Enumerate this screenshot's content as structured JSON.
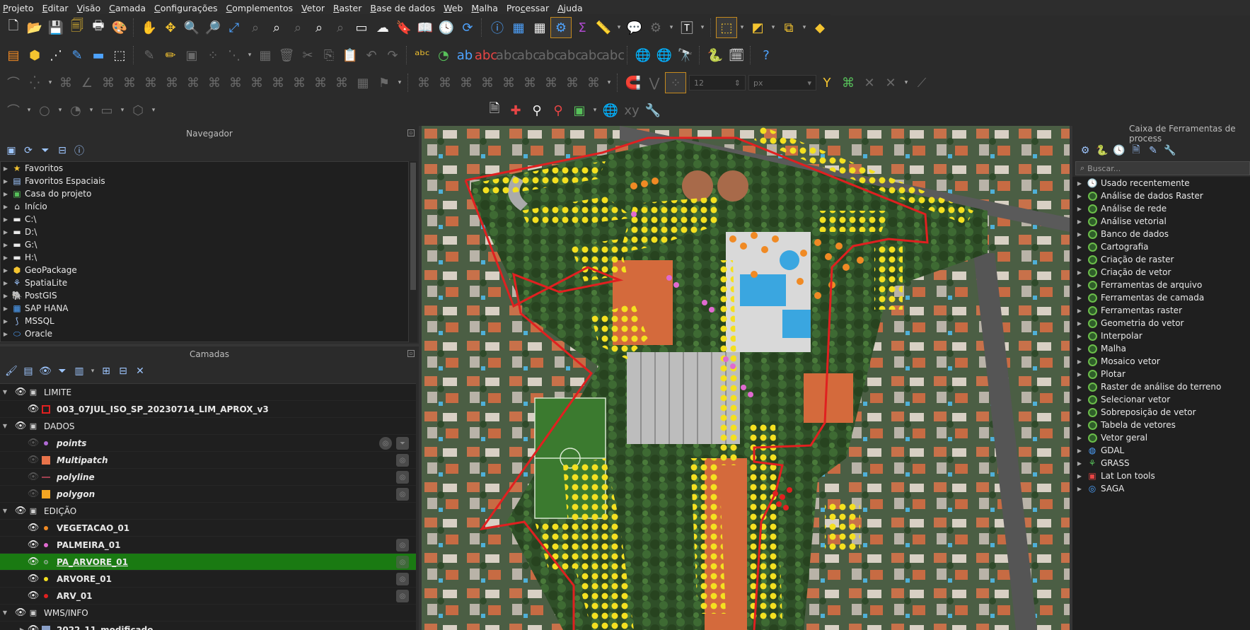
{
  "menubar": {
    "items": [
      {
        "pre": "",
        "u": "P",
        "post": "rojeto"
      },
      {
        "pre": "",
        "u": "E",
        "post": "ditar"
      },
      {
        "pre": "",
        "u": "V",
        "post": "isão"
      },
      {
        "pre": "",
        "u": "C",
        "post": "amada"
      },
      {
        "pre": "",
        "u": "C",
        "post": "onfigurações"
      },
      {
        "pre": "",
        "u": "C",
        "post": "omplementos"
      },
      {
        "pre": "",
        "u": "V",
        "post": "etor"
      },
      {
        "pre": "",
        "u": "R",
        "post": "aster"
      },
      {
        "pre": "",
        "u": "B",
        "post": "ase de dados"
      },
      {
        "pre": "",
        "u": "W",
        "post": "eb"
      },
      {
        "pre": "",
        "u": "M",
        "post": "alha"
      },
      {
        "pre": "Pro",
        "u": "c",
        "post": "essar"
      },
      {
        "pre": "",
        "u": "A",
        "post": "juda"
      }
    ]
  },
  "toolbar": {
    "snap_tolerance": "12",
    "snap_unit": "px"
  },
  "navigator": {
    "title": "Navegador",
    "items": [
      {
        "label": "Favoritos",
        "icon": "star-icon"
      },
      {
        "label": "Favoritos Espaciais",
        "icon": "spatial-bookmarks-icon"
      },
      {
        "label": "Casa do projeto",
        "icon": "project-home-icon"
      },
      {
        "label": "Início",
        "icon": "home-icon"
      },
      {
        "label": "C:\\",
        "icon": "folder-icon"
      },
      {
        "label": "D:\\",
        "icon": "folder-icon"
      },
      {
        "label": "G:\\",
        "icon": "folder-icon"
      },
      {
        "label": "H:\\",
        "icon": "folder-icon"
      },
      {
        "label": "GeoPackage",
        "icon": "geopackage-icon"
      },
      {
        "label": "SpatiaLite",
        "icon": "spatialite-icon"
      },
      {
        "label": "PostGIS",
        "icon": "postgis-icon"
      },
      {
        "label": "SAP HANA",
        "icon": "sap-hana-icon"
      },
      {
        "label": "MSSQL",
        "icon": "mssql-icon"
      },
      {
        "label": "Oracle",
        "icon": "oracle-icon"
      }
    ]
  },
  "layers": {
    "title": "Camadas",
    "groups": {
      "limite": "LIMITE",
      "dados": "DADOS",
      "edicao": "EDIÇÃO",
      "wms": "WMS/INFO"
    },
    "items": {
      "lim": "003_07JUL_ISO_SP_20230714_LIM_APROX_v3",
      "points": "points",
      "multipatch": "Multipatch",
      "polyline": "polyline",
      "polygon": "polygon",
      "vegetacao": "VEGETACAO_01",
      "palmeira": "PALMEIRA_01",
      "pa_arvore": "PA_ARVORE_01",
      "arvore": "ARVORE_01",
      "arv": "ARV_01",
      "wms_item": "2022_11_modificado"
    },
    "colors": {
      "lim": "#e02020",
      "points": "#b06ad6",
      "multipatch": "#e8734a",
      "polyline": "#a04050",
      "polygon": "#f5a623",
      "vegetacao": "#f08a24",
      "palmeira": "#e06ad0",
      "pa_arvore": "#3a9a3a",
      "arvore": "#f4e020",
      "arv": "#e02020"
    }
  },
  "toolbox": {
    "title": "Caixa de Ferramentas de process",
    "search_placeholder": "Buscar...",
    "items": [
      {
        "label": "Usado recentemente",
        "icon": "clock-icon"
      },
      {
        "label": "Análise de dados Raster",
        "icon": "qgis-icon"
      },
      {
        "label": "Análise de rede",
        "icon": "qgis-icon"
      },
      {
        "label": "Análise vetorial",
        "icon": "qgis-icon"
      },
      {
        "label": "Banco de dados",
        "icon": "qgis-icon"
      },
      {
        "label": "Cartografia",
        "icon": "qgis-icon"
      },
      {
        "label": "Criação de raster",
        "icon": "qgis-icon"
      },
      {
        "label": "Criação de vetor",
        "icon": "qgis-icon"
      },
      {
        "label": "Ferramentas de arquivo",
        "icon": "qgis-icon"
      },
      {
        "label": "Ferramentas de camada",
        "icon": "qgis-icon"
      },
      {
        "label": "Ferramentas raster",
        "icon": "qgis-icon"
      },
      {
        "label": "Geometria do vetor",
        "icon": "qgis-icon"
      },
      {
        "label": "Interpolar",
        "icon": "qgis-icon"
      },
      {
        "label": "Malha",
        "icon": "qgis-icon"
      },
      {
        "label": "Mosaico vetor",
        "icon": "qgis-icon"
      },
      {
        "label": "Plotar",
        "icon": "qgis-icon"
      },
      {
        "label": "Raster de análise do terreno",
        "icon": "qgis-icon"
      },
      {
        "label": "Selecionar vetor",
        "icon": "qgis-icon"
      },
      {
        "label": "Sobreposição de vetor",
        "icon": "qgis-icon"
      },
      {
        "label": "Tabela de vetores",
        "icon": "qgis-icon"
      },
      {
        "label": "Vetor geral",
        "icon": "qgis-icon"
      },
      {
        "label": "GDAL",
        "icon": "gdal-icon"
      },
      {
        "label": "GRASS",
        "icon": "grass-icon"
      },
      {
        "label": "Lat Lon tools",
        "icon": "latlon-icon"
      },
      {
        "label": "SAGA",
        "icon": "saga-icon"
      }
    ]
  }
}
